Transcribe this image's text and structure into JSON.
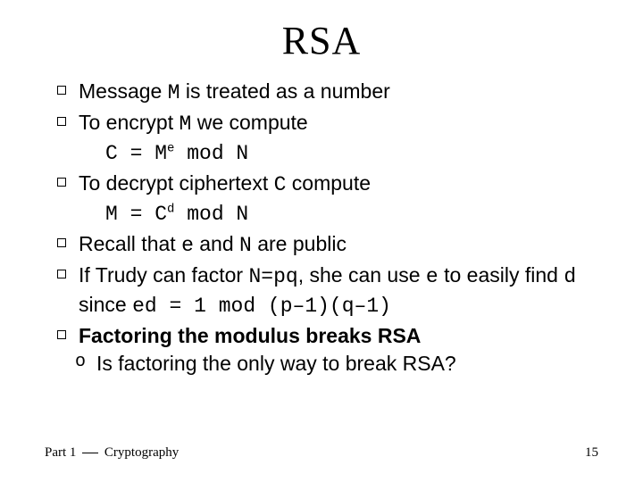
{
  "title": "RSA",
  "bullets": {
    "b1_a": "Message ",
    "b1_m": "M",
    "b1_b": " is treated as a number",
    "b2_a": "To encrypt ",
    "b2_m": "M",
    "b2_b": " we compute",
    "b2_eq_a": "C = M",
    "b2_eq_sup": "e",
    "b2_eq_b": " mod N",
    "b3_a": "To decrypt ciphertext ",
    "b3_c": "C",
    "b3_b": " compute",
    "b3_eq_a": "M = C",
    "b3_eq_sup": "d",
    "b3_eq_b": " mod N",
    "b4_a": "Recall that ",
    "b4_e": "e",
    "b4_b": " and ",
    "b4_n": "N",
    "b4_c": " are public",
    "b5_a": "If Trudy can factor ",
    "b5_eq1": "N=pq",
    "b5_b": ", she can use ",
    "b5_e": "e",
    "b5_c": " to easily find ",
    "b5_d": "d",
    "b5_dd": " since ",
    "b5_eq2": "ed = 1 mod (p–1)(q–1)",
    "b6": "Factoring the modulus breaks RSA",
    "sub1": "Is factoring the only way to break RSA?"
  },
  "footer": {
    "part": "Part 1 ",
    "topic": " Cryptography",
    "page": "15"
  }
}
